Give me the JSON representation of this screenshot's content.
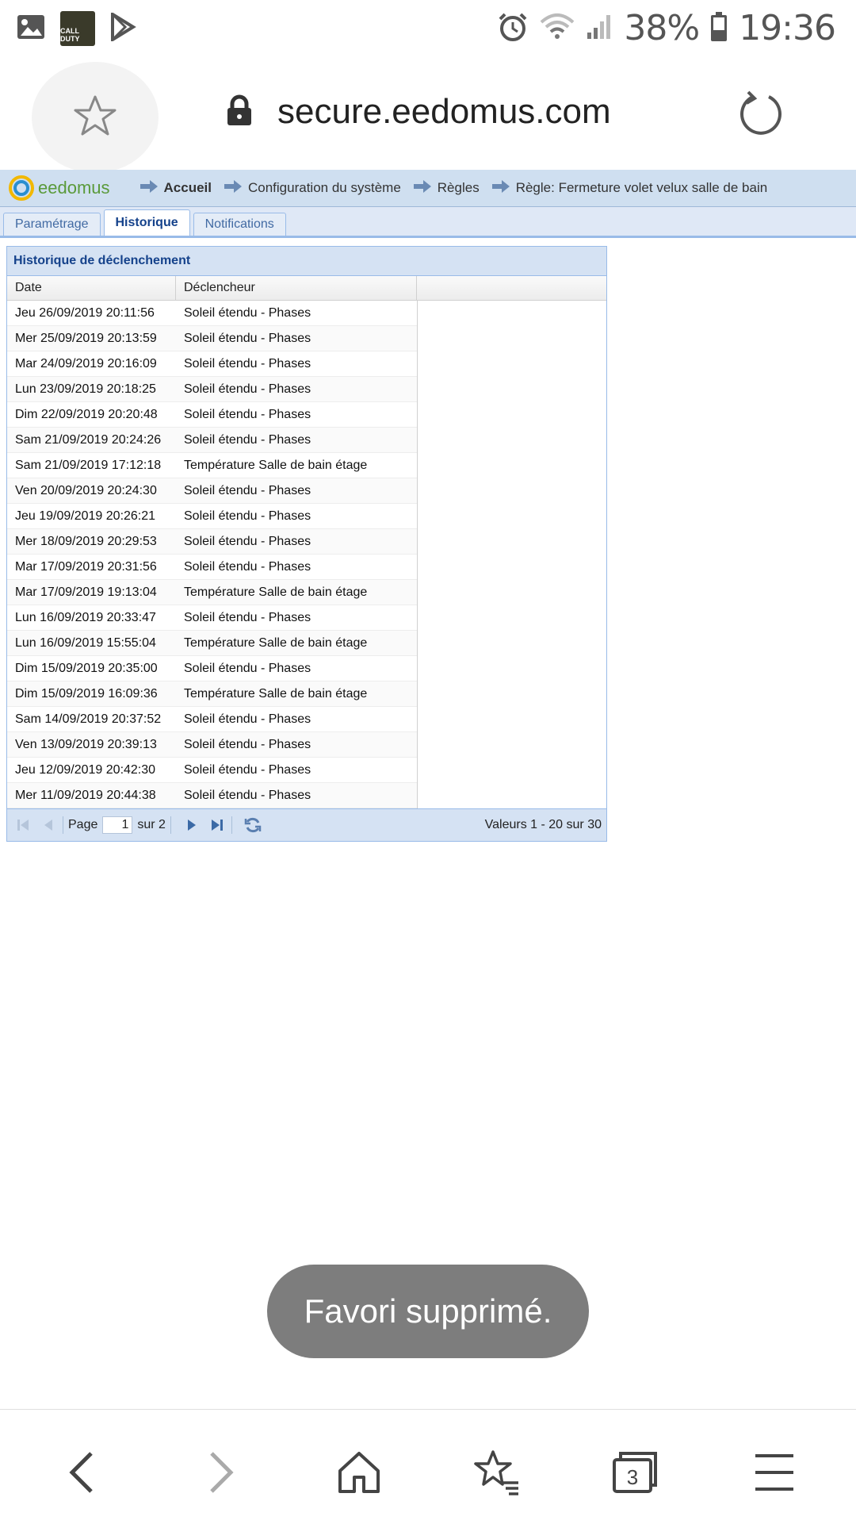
{
  "status_bar": {
    "battery": "38%",
    "time": "19:36",
    "game_icon_label": "CALL DUTY"
  },
  "browser": {
    "url": "secure.eedomus.com"
  },
  "app": {
    "logo": "eedomus",
    "breadcrumbs": [
      "Accueil",
      "Configuration du système",
      "Règles",
      "Règle: Fermeture volet velux salle de bain"
    ],
    "tabs": [
      "Paramétrage",
      "Historique",
      "Notifications"
    ],
    "active_tab": "Historique"
  },
  "panel": {
    "title": "Historique de déclenchement",
    "columns": [
      "Date",
      "Déclencheur",
      ""
    ],
    "rows": [
      {
        "date": "Jeu 26/09/2019 20:11:56",
        "trigger": "Soleil étendu - Phases"
      },
      {
        "date": "Mer 25/09/2019 20:13:59",
        "trigger": "Soleil étendu - Phases"
      },
      {
        "date": "Mar 24/09/2019 20:16:09",
        "trigger": "Soleil étendu - Phases"
      },
      {
        "date": "Lun 23/09/2019 20:18:25",
        "trigger": "Soleil étendu - Phases"
      },
      {
        "date": "Dim 22/09/2019 20:20:48",
        "trigger": "Soleil étendu - Phases"
      },
      {
        "date": "Sam 21/09/2019 20:24:26",
        "trigger": "Soleil étendu - Phases"
      },
      {
        "date": "Sam 21/09/2019 17:12:18",
        "trigger": "Température Salle de bain étage"
      },
      {
        "date": "Ven 20/09/2019 20:24:30",
        "trigger": "Soleil étendu - Phases"
      },
      {
        "date": "Jeu 19/09/2019 20:26:21",
        "trigger": "Soleil étendu - Phases"
      },
      {
        "date": "Mer 18/09/2019 20:29:53",
        "trigger": "Soleil étendu - Phases"
      },
      {
        "date": "Mar 17/09/2019 20:31:56",
        "trigger": "Soleil étendu - Phases"
      },
      {
        "date": "Mar 17/09/2019 19:13:04",
        "trigger": "Température Salle de bain étage"
      },
      {
        "date": "Lun 16/09/2019 20:33:47",
        "trigger": "Soleil étendu - Phases"
      },
      {
        "date": "Lun 16/09/2019 15:55:04",
        "trigger": "Température Salle de bain étage"
      },
      {
        "date": "Dim 15/09/2019 20:35:00",
        "trigger": "Soleil étendu - Phases"
      },
      {
        "date": "Dim 15/09/2019 16:09:36",
        "trigger": "Température Salle de bain étage"
      },
      {
        "date": "Sam 14/09/2019 20:37:52",
        "trigger": "Soleil étendu - Phases"
      },
      {
        "date": "Ven 13/09/2019 20:39:13",
        "trigger": "Soleil étendu - Phases"
      },
      {
        "date": "Jeu 12/09/2019 20:42:30",
        "trigger": "Soleil étendu - Phases"
      },
      {
        "date": "Mer 11/09/2019 20:44:38",
        "trigger": "Soleil étendu - Phases"
      }
    ],
    "pager": {
      "page_label": "Page",
      "page_value": "1",
      "of_label": "sur 2",
      "info": "Valeurs 1 - 20 sur 30"
    }
  },
  "toast": "Favori supprimé.",
  "bottom_nav": {
    "tab_count": "3",
    "icons": [
      "back-icon",
      "forward-icon",
      "home-icon",
      "bookmarks-icon",
      "tabs-icon",
      "menu-icon"
    ]
  },
  "colors": {
    "header_bg": "#cfdff0",
    "panel_title": "#15428b",
    "toast_bg": "#7d7d7d"
  }
}
